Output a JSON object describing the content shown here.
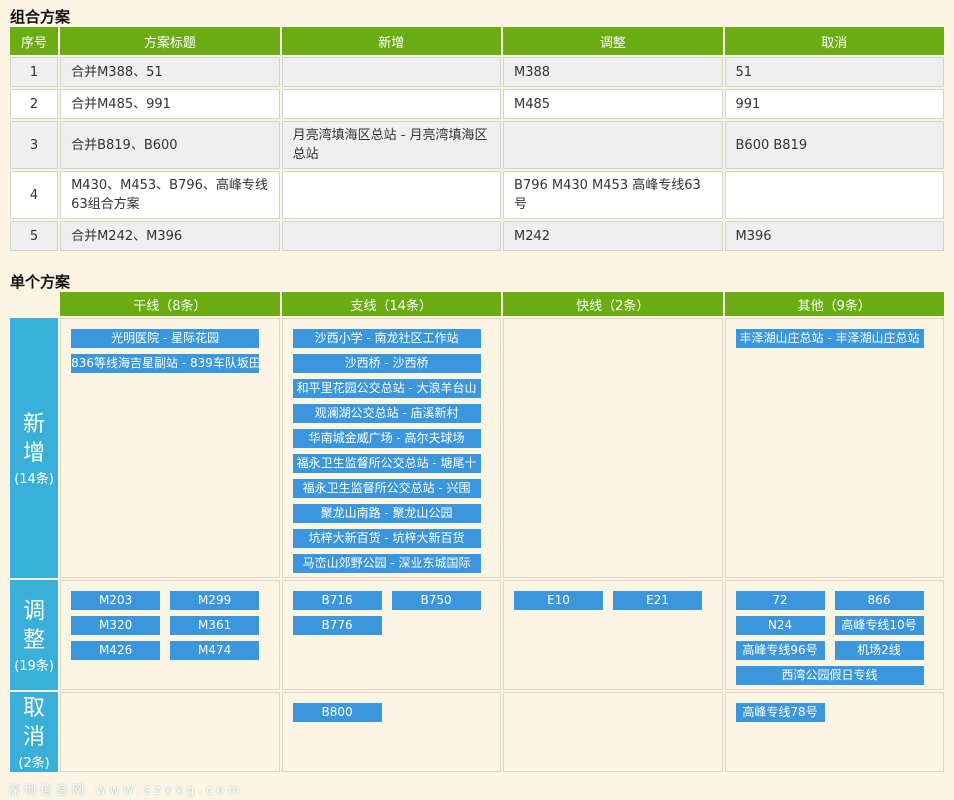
{
  "combo": {
    "title": "组合方案",
    "headers": [
      "序号",
      "方案标题",
      "新增",
      "调整",
      "取消"
    ],
    "rows": [
      {
        "no": "1",
        "title": "合并M388、51",
        "add": "",
        "adjust": "M388",
        "cancel": "51"
      },
      {
        "no": "2",
        "title": "合并M485、991",
        "add": "",
        "adjust": "M485",
        "cancel": "991"
      },
      {
        "no": "3",
        "title": "合并B819、B600",
        "add": "月亮湾填海区总站 - 月亮湾填海区总站",
        "adjust": "",
        "cancel": "B600 B819"
      },
      {
        "no": "4",
        "title": "M430、M453、B796、高峰专线63组合方案",
        "add": "",
        "adjust": "B796 M430 M453 高峰专线63号",
        "cancel": ""
      },
      {
        "no": "5",
        "title": "合并M242、M396",
        "add": "",
        "adjust": "M242",
        "cancel": "M396"
      }
    ]
  },
  "single": {
    "title": "单个方案",
    "columns": [
      "干线（8条）",
      "支线（14条）",
      "快线（2条）",
      "其他（9条）"
    ],
    "rows": {
      "add": {
        "label_top": "新",
        "label_bottom": "增",
        "count": "(14条)",
        "trunk": [
          "光明医院 - 星际花园",
          "836等线海吉星副站 - 839车队坂田"
        ],
        "branch": [
          "沙西小学 - 南龙社区工作站",
          "沙西桥 - 沙西桥",
          "和平里花园公交总站 - 大浪羊台山",
          "观澜湖公交总站 - 庙溪新村",
          "华南城金威广场 - 高尔夫球场",
          "福永卫生监督所公交总站 - 塘尾十",
          "福永卫生监督所公交总站 - 兴围",
          "聚龙山南路 - 聚龙山公园",
          "坑梓大新百货 - 坑梓大新百货",
          "马峦山郊野公园 - 深业东城国际"
        ],
        "express": [],
        "other": [
          "丰泽湖山庄总站 - 丰泽湖山庄总站"
        ]
      },
      "adjust": {
        "label_top": "调",
        "label_bottom": "整",
        "count": "(19条)",
        "trunk": [
          "M203",
          "M299",
          "M320",
          "M361",
          "M426",
          "M474"
        ],
        "branch": [
          "B716",
          "B750",
          "B776"
        ],
        "express": [
          "E10",
          "E21"
        ],
        "other": [
          "72",
          "866",
          "N24",
          "高峰专线10号",
          "高峰专线96号",
          "机场2线",
          "西湾公园假日专线"
        ]
      },
      "cancel": {
        "label_top": "取",
        "label_bottom": "消",
        "count": "(2条)",
        "trunk": [],
        "branch": [
          "B800"
        ],
        "express": [],
        "other": [
          "高峰专线78号"
        ]
      }
    }
  },
  "watermark": "深圳信息网 www.szxxg.com"
}
